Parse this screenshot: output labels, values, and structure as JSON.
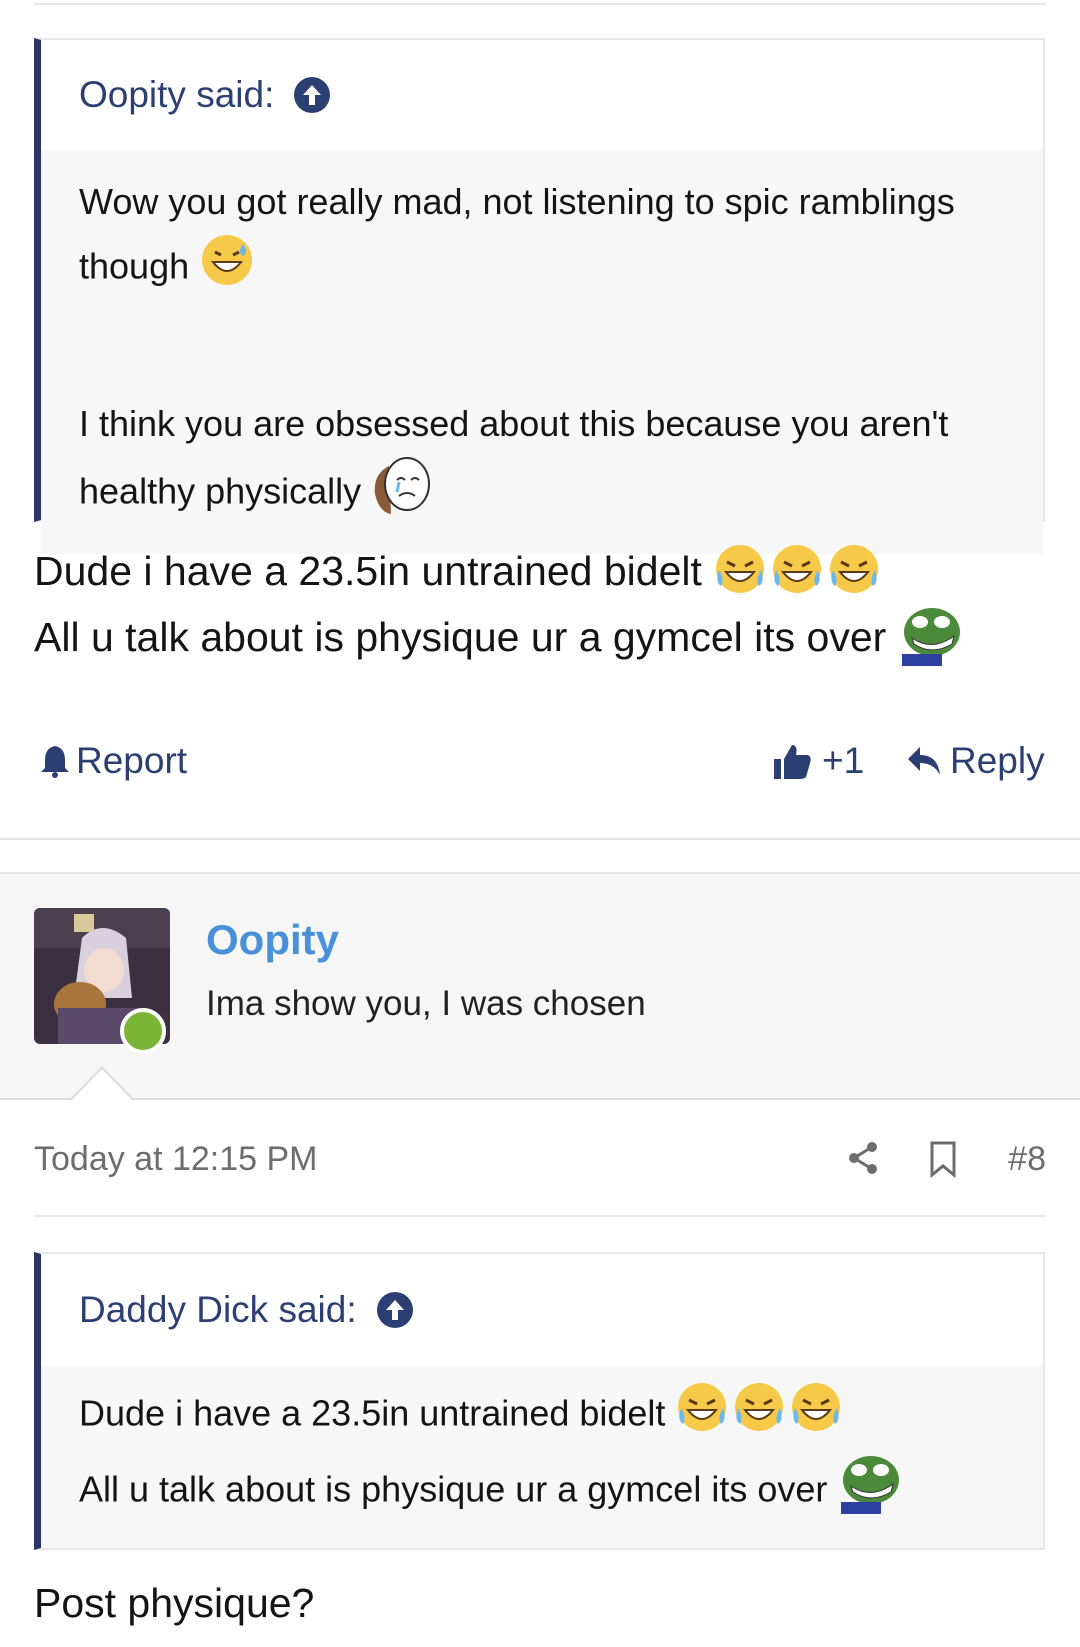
{
  "quote1": {
    "author_label": "Oopity said:",
    "lines": [
      "Wow you got really mad, not listening to spic ramblings",
      "though",
      "I think you are obsessed about this because you aren't",
      "healthy physically"
    ]
  },
  "post1": {
    "lines": [
      "Dude i have a 23.5in untrained bidelt",
      "All u talk about is physique ur a gymcel its over"
    ],
    "actions": {
      "report_label": "Report",
      "like_count": "+1",
      "reply_label": "Reply"
    }
  },
  "post2": {
    "username": "Oopity",
    "user_title": "Ima show you, I was chosen",
    "timestamp": "Today at 12:15 PM",
    "post_number": "#8",
    "quote": {
      "author_label": "Daddy Dick said:",
      "lines": [
        "Dude i have a 23.5in untrained bidelt",
        "All u talk about is physique ur a gymcel its over"
      ]
    },
    "message": "Post physique?"
  },
  "colors": {
    "link": "#2b3f73",
    "quote_bar": "#2a3566",
    "username": "#4a90d9",
    "online": "#7ab535"
  },
  "icons": [
    "arrow-up-circle-icon",
    "grinning-sweat-emoji",
    "crying-wojak-emoji",
    "tears-of-joy-emoji",
    "pepe-laugh-emoji",
    "bell-icon",
    "thumbs-up-icon",
    "reply-arrow-icon",
    "share-icon",
    "bookmark-icon"
  ]
}
